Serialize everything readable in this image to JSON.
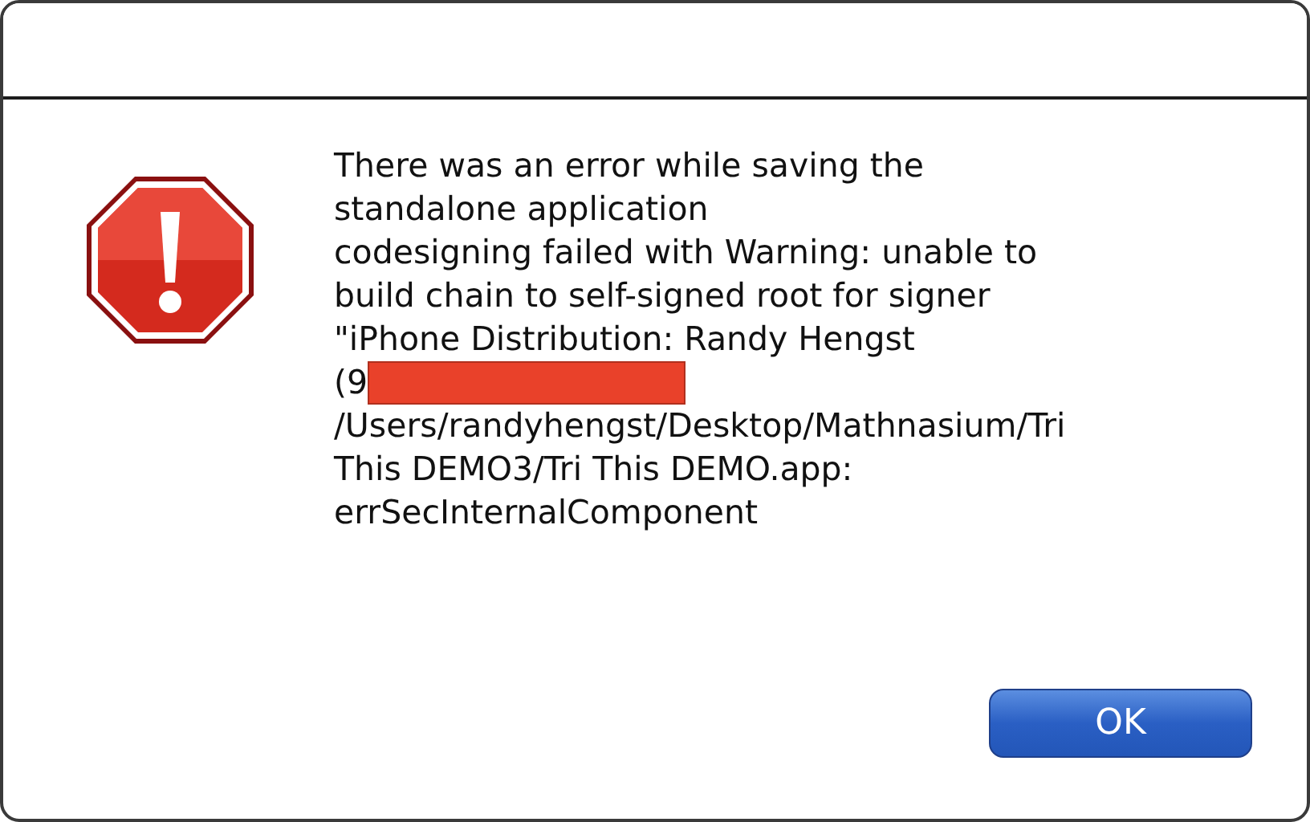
{
  "dialog": {
    "kind": "error",
    "message_lines": [
      {
        "text": "There was an error while saving the",
        "redacted": false
      },
      {
        "text": "standalone application",
        "redacted": false
      },
      {
        "text": "codesigning failed with Warning: unable to",
        "redacted": false
      },
      {
        "text": "build chain to self-signed root for signer",
        "redacted": false
      },
      {
        "text": "\"iPhone Distribution: Randy Hengst",
        "redacted": false
      },
      {
        "text": "(9",
        "redacted": true
      },
      {
        "text": "/Users/randyhengst/Desktop/Mathnasium/Tri",
        "redacted": false
      },
      {
        "text": "This DEMO3/Tri This DEMO.app:",
        "redacted": false
      },
      {
        "text": "errSecInternalComponent",
        "redacted": false
      }
    ],
    "buttons": [
      {
        "label": "OK",
        "default": true
      }
    ]
  }
}
